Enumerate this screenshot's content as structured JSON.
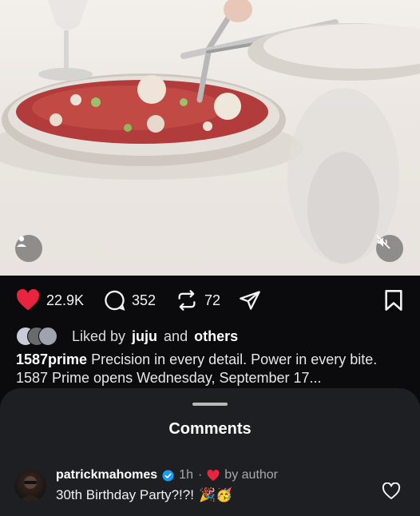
{
  "post": {
    "likes": "22.9K",
    "comments": "352",
    "reposts": "72",
    "liked_by_prefix": "Liked by",
    "liked_by_user": "juju",
    "liked_by_and": "and",
    "liked_by_others": "others",
    "caption_user": "1587prime",
    "caption_text": "Precision in every detail. Power in every bite. 1587 Prime opens Wednesday, September 17..."
  },
  "sheet": {
    "title": "Comments"
  },
  "comment": {
    "username": "patrickmahomes",
    "time": "1h",
    "separator": "·",
    "by_author": "by author",
    "text": "30th Birthday Party?!?!",
    "emojis": "🎉🥳"
  },
  "colors": {
    "like_red": "#e8243f",
    "verified_blue": "#1d9bf0",
    "sheet_bg": "#1d1f23"
  },
  "icons": [
    "user-icon",
    "mute-icon",
    "heart-icon",
    "comment-icon",
    "repost-icon",
    "share-icon",
    "bookmark-icon",
    "verified-icon",
    "small-heart-icon",
    "heart-outline-icon"
  ]
}
